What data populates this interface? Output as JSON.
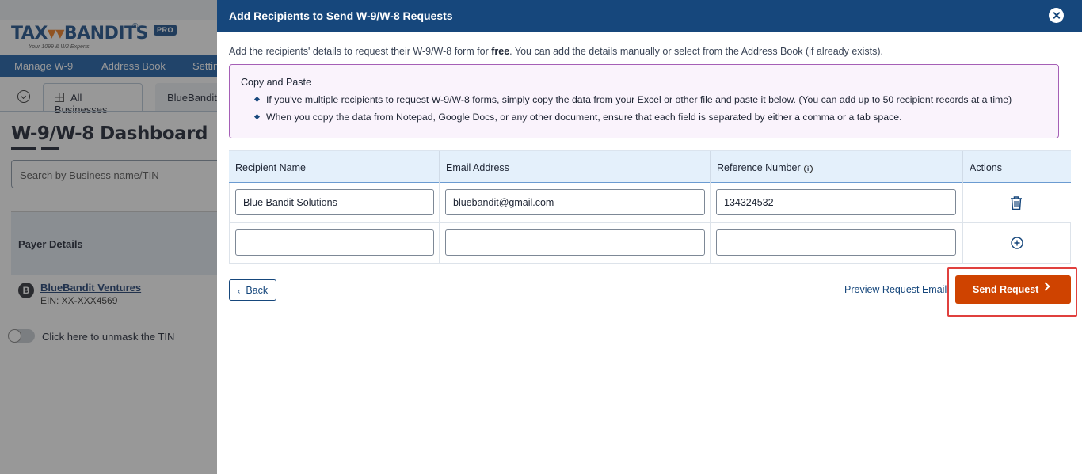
{
  "background": {
    "logo": {
      "text_a": "TAX",
      "text_owl": "▾▾",
      "text_b": "BANDITS",
      "reg": "®",
      "badge": "PRO",
      "tagline": "Your 1099 & W2 Experts"
    },
    "nav": {
      "items": [
        "Manage W-9",
        "Address Book",
        "Settin"
      ]
    },
    "tabs": {
      "all_businesses": "All Businesses",
      "bluebandit": "BlueBandit"
    },
    "page_title": "W-9/W-8 Dashboard",
    "search_placeholder": "Search by Business name/TIN",
    "table_header": "Payer Details",
    "row": {
      "avatar": "B",
      "business": "BlueBandit Ventures",
      "ein": "EIN: XX-XXX4569"
    },
    "toggle_label": "Click here to unmask the TIN"
  },
  "drawer": {
    "title": "Add Recipients to Send W-9/W-8 Requests",
    "intro_pre": "Add the recipients' details to request their W-9/W-8 form for ",
    "intro_bold": "free",
    "intro_post": ". You can add the details manually or select from the Address Book (if already exists).",
    "copy_paste": {
      "title": "Copy and Paste",
      "items": [
        "If you've multiple recipients to request W-9/W-8 forms, simply copy the data from your Excel or other file and paste it below. (You can add up to 50 recipient records at a time)",
        "When you copy the data from Notepad, Google Docs, or any other document, ensure that each field is separated by either a comma or a tab space."
      ]
    },
    "table": {
      "headers": {
        "name": "Recipient Name",
        "email": "Email Address",
        "reference": "Reference Number",
        "actions": "Actions"
      },
      "rows": [
        {
          "name": "Blue Bandit Solutions",
          "email": "bluebandit@gmail.com",
          "reference": "134324532"
        },
        {
          "name": "",
          "email": "",
          "reference": ""
        }
      ]
    },
    "back_label": "Back",
    "preview_label": "Preview Request Email",
    "send_label": "Send Request"
  },
  "colors": {
    "header": "#16477c",
    "send_button": "#cf4300",
    "highlight": "#e0403e",
    "copy_box_border": "#a55fb6"
  }
}
